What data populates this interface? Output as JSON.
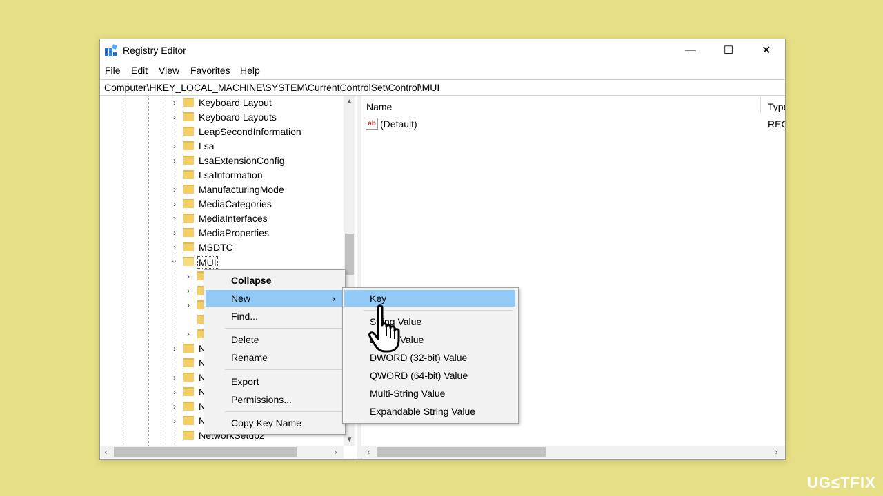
{
  "window": {
    "title": "Registry Editor",
    "controls": {
      "minimize": "—",
      "maximize": "☐",
      "close": "✕"
    }
  },
  "menubar": [
    "File",
    "Edit",
    "View",
    "Favorites",
    "Help"
  ],
  "address": "Computer\\HKEY_LOCAL_MACHINE\\SYSTEM\\CurrentControlSet\\Control\\MUI",
  "tree": {
    "items": [
      {
        "label": "Keyboard Layout",
        "expandable": true
      },
      {
        "label": "Keyboard Layouts",
        "expandable": true
      },
      {
        "label": "LeapSecondInformation",
        "expandable": false
      },
      {
        "label": "Lsa",
        "expandable": true
      },
      {
        "label": "LsaExtensionConfig",
        "expandable": true
      },
      {
        "label": "LsaInformation",
        "expandable": false
      },
      {
        "label": "ManufacturingMode",
        "expandable": true
      },
      {
        "label": "MediaCategories",
        "expandable": true
      },
      {
        "label": "MediaInterfaces",
        "expandable": true
      },
      {
        "label": "MediaProperties",
        "expandable": true
      },
      {
        "label": "MSDTC",
        "expandable": true
      },
      {
        "label": "MUI",
        "expandable": true,
        "expanded": true,
        "selected": true
      }
    ],
    "hidden_rows": [
      "N",
      "N",
      "N",
      "N",
      "N",
      "N"
    ],
    "last_item": "NetworkSetup2"
  },
  "right_pane": {
    "columns": {
      "name": "Name",
      "type": "Type"
    },
    "rows": [
      {
        "name": "(Default)",
        "type": "REG",
        "icon": "ab-string-icon"
      }
    ]
  },
  "context_menu": {
    "items": [
      {
        "label": "Collapse",
        "bold": true
      },
      {
        "label": "New",
        "submenu": true,
        "highlighted": true
      },
      {
        "label": "Find..."
      },
      {
        "label": "Delete"
      },
      {
        "label": "Rename"
      },
      {
        "label": "Export"
      },
      {
        "label": "Permissions..."
      },
      {
        "label": "Copy Key Name"
      }
    ]
  },
  "submenu": {
    "items": [
      {
        "label": "Key",
        "highlighted": true
      },
      {
        "label": "String Value"
      },
      {
        "label": "Binary Value"
      },
      {
        "label": "DWORD (32-bit) Value"
      },
      {
        "label": "QWORD (64-bit) Value"
      },
      {
        "label": "Multi-String Value"
      },
      {
        "label": "Expandable String Value"
      }
    ]
  },
  "colors": {
    "background": "#e6df85",
    "highlight": "#91c9f7",
    "folder": "#f4cf63"
  },
  "watermark": {
    "prefix": "UG",
    "accent": "≤T",
    "suffix": "FIX"
  }
}
